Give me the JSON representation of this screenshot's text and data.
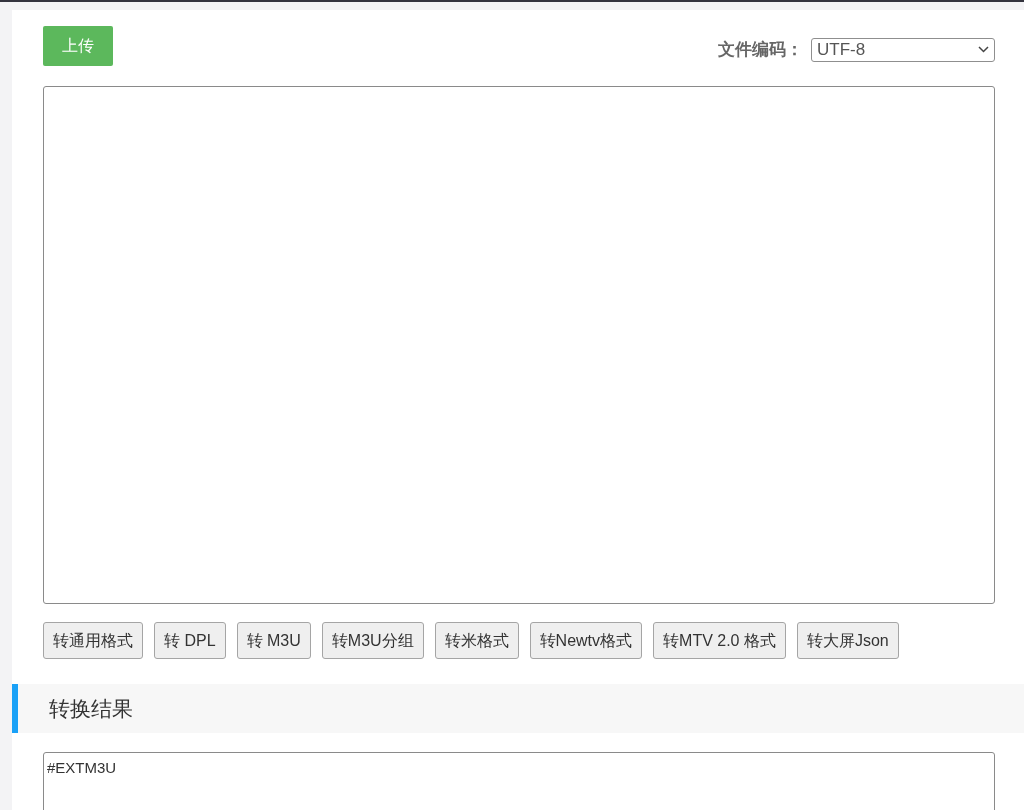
{
  "upload_button": {
    "label": "上传"
  },
  "encoding": {
    "label": "文件编码：",
    "value": "UTF-8"
  },
  "convert_buttons": [
    "转通用格式",
    "转 DPL",
    "转 M3U",
    "转M3U分组",
    "转米格式",
    "转Newtv格式",
    "转MTV 2.0 格式",
    "转大屏Json"
  ],
  "result_section": {
    "title": "转换结果",
    "output": "#EXTM3U"
  }
}
